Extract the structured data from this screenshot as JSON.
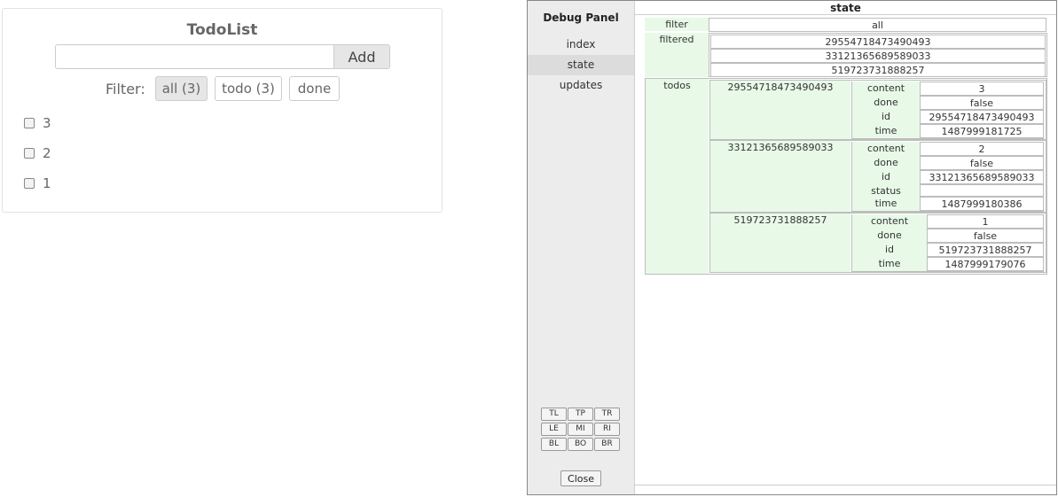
{
  "todo_app": {
    "title": "TodoList",
    "input_value": "",
    "input_placeholder": "",
    "add_label": "Add",
    "filter_label": "Filter:",
    "filters": {
      "all": "all (3)",
      "todo": "todo (3)",
      "done": "done"
    },
    "active_filter": "all",
    "items": [
      {
        "text": "3",
        "checked": false
      },
      {
        "text": "2",
        "checked": false
      },
      {
        "text": "1",
        "checked": false
      }
    ]
  },
  "debug_panel": {
    "title": "Debug Panel",
    "nav": {
      "index": "index",
      "state": "state",
      "updates": "updates"
    },
    "selected_nav": "state",
    "positions": {
      "tl": "TL",
      "tp": "TP",
      "tr": "TR",
      "le": "LE",
      "mi": "MI",
      "ri": "RI",
      "bl": "BL",
      "bo": "BO",
      "br": "BR"
    },
    "close_label": "Close",
    "state_title": "state",
    "state": {
      "filter_key": "filter",
      "filter_value": "all",
      "filtered_key": "filtered",
      "filtered": [
        "29554718473490493",
        "33121365689589033",
        "519723731888257"
      ],
      "todos_key": "todos",
      "todos": [
        {
          "key": "29554718473490493",
          "fields": [
            {
              "k": "content",
              "v": "3"
            },
            {
              "k": "done",
              "v": "false"
            },
            {
              "k": "id",
              "v": "29554718473490493"
            },
            {
              "k": "time",
              "v": "1487999181725"
            }
          ]
        },
        {
          "key": "33121365689589033",
          "fields": [
            {
              "k": "content",
              "v": "2"
            },
            {
              "k": "done",
              "v": "false"
            },
            {
              "k": "id",
              "v": "33121365689589033"
            },
            {
              "k": "status",
              "v": ""
            },
            {
              "k": "time",
              "v": "1487999180386"
            }
          ]
        },
        {
          "key": "519723731888257",
          "fields": [
            {
              "k": "content",
              "v": "1"
            },
            {
              "k": "done",
              "v": "false"
            },
            {
              "k": "id",
              "v": "519723731888257"
            },
            {
              "k": "time",
              "v": "1487999179076"
            }
          ]
        }
      ]
    }
  }
}
